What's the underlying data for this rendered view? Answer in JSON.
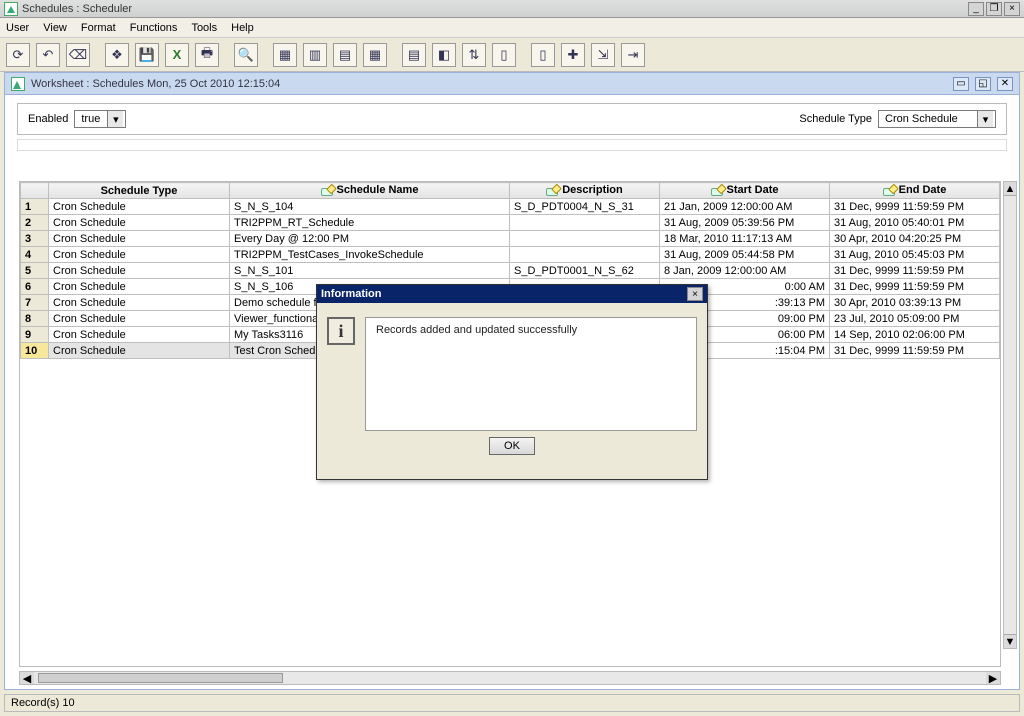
{
  "window": {
    "title": "Schedules : Scheduler",
    "controls": {
      "minimize": "_",
      "maximize": "❐",
      "close": "×"
    }
  },
  "menu": [
    "User",
    "View",
    "Format",
    "Functions",
    "Tools",
    "Help"
  ],
  "toolbar_icons": [
    "refresh",
    "undo",
    "erase",
    "divider",
    "wizard",
    "save",
    "excel",
    "print",
    "divider",
    "find",
    "divider",
    "props",
    "column",
    "insert-row",
    "grid",
    "divider",
    "calendar",
    "palette",
    "sort",
    "doc",
    "divider",
    "paste",
    "new-row",
    "import",
    "exit"
  ],
  "worksheet": {
    "title": "Worksheet : Schedules Mon, 25 Oct 2010 12:15:04"
  },
  "filter": {
    "enabled_label": "Enabled",
    "enabled_value": "true",
    "type_label": "Schedule Type",
    "type_value": "Cron Schedule"
  },
  "columns": [
    "Schedule Type",
    "Schedule Name",
    "Description",
    "Start Date",
    "End Date"
  ],
  "rows": [
    {
      "n": "1",
      "type": "Cron Schedule",
      "name": "S_N_S_104",
      "desc": "S_D_PDT0004_N_S_31",
      "start": "21 Jan, 2009 12:00:00 AM",
      "end": "31 Dec, 9999 11:59:59 PM"
    },
    {
      "n": "2",
      "type": "Cron Schedule",
      "name": "TRI2PPM_RT_Schedule",
      "desc": "",
      "start": "31 Aug, 2009 05:39:56 PM",
      "end": "31 Aug, 2010 05:40:01 PM"
    },
    {
      "n": "3",
      "type": "Cron Schedule",
      "name": "Every Day @ 12:00 PM",
      "desc": "",
      "start": "18 Mar, 2010 11:17:13 AM",
      "end": "30 Apr, 2010 04:20:25 PM"
    },
    {
      "n": "4",
      "type": "Cron Schedule",
      "name": "TRI2PPM_TestCases_InvokeSchedule",
      "desc": "",
      "start": "31 Aug, 2009 05:44:58 PM",
      "end": "31 Aug, 2010 05:45:03 PM"
    },
    {
      "n": "5",
      "type": "Cron Schedule",
      "name": "S_N_S_101",
      "desc": "S_D_PDT0001_N_S_62",
      "start": "8 Jan, 2009 12:00:00 AM",
      "end": "31 Dec, 9999 11:59:59 PM"
    },
    {
      "n": "6",
      "type": "Cron Schedule",
      "name": "S_N_S_106",
      "desc": "",
      "start_suffix": "0:00 AM",
      "end": "31 Dec, 9999 11:59:59 PM"
    },
    {
      "n": "7",
      "type": "Cron Schedule",
      "name": "Demo schedule for tes",
      "desc": "",
      "start_suffix": ":39:13 PM",
      "end": "30 Apr, 2010 03:39:13 PM"
    },
    {
      "n": "8",
      "type": "Cron Schedule",
      "name": "Viewer_functional_rep",
      "desc": "",
      "start_suffix": "09:00 PM",
      "end": "23 Jul, 2010 05:09:00 PM"
    },
    {
      "n": "9",
      "type": "Cron Schedule",
      "name": "My Tasks3116",
      "desc": "",
      "start_suffix": "06:00 PM",
      "end": "14 Sep, 2010 02:06:00 PM"
    },
    {
      "n": "10",
      "type": "Cron Schedule",
      "name": "Test Cron Schedule",
      "desc": "",
      "start_suffix": ":15:04 PM",
      "end": "31 Dec, 9999 11:59:59 PM",
      "selected": true
    }
  ],
  "dialog": {
    "title": "Information",
    "message": "Records added and updated successfully",
    "ok": "OK",
    "close": "×"
  },
  "status": "Record(s) 10"
}
